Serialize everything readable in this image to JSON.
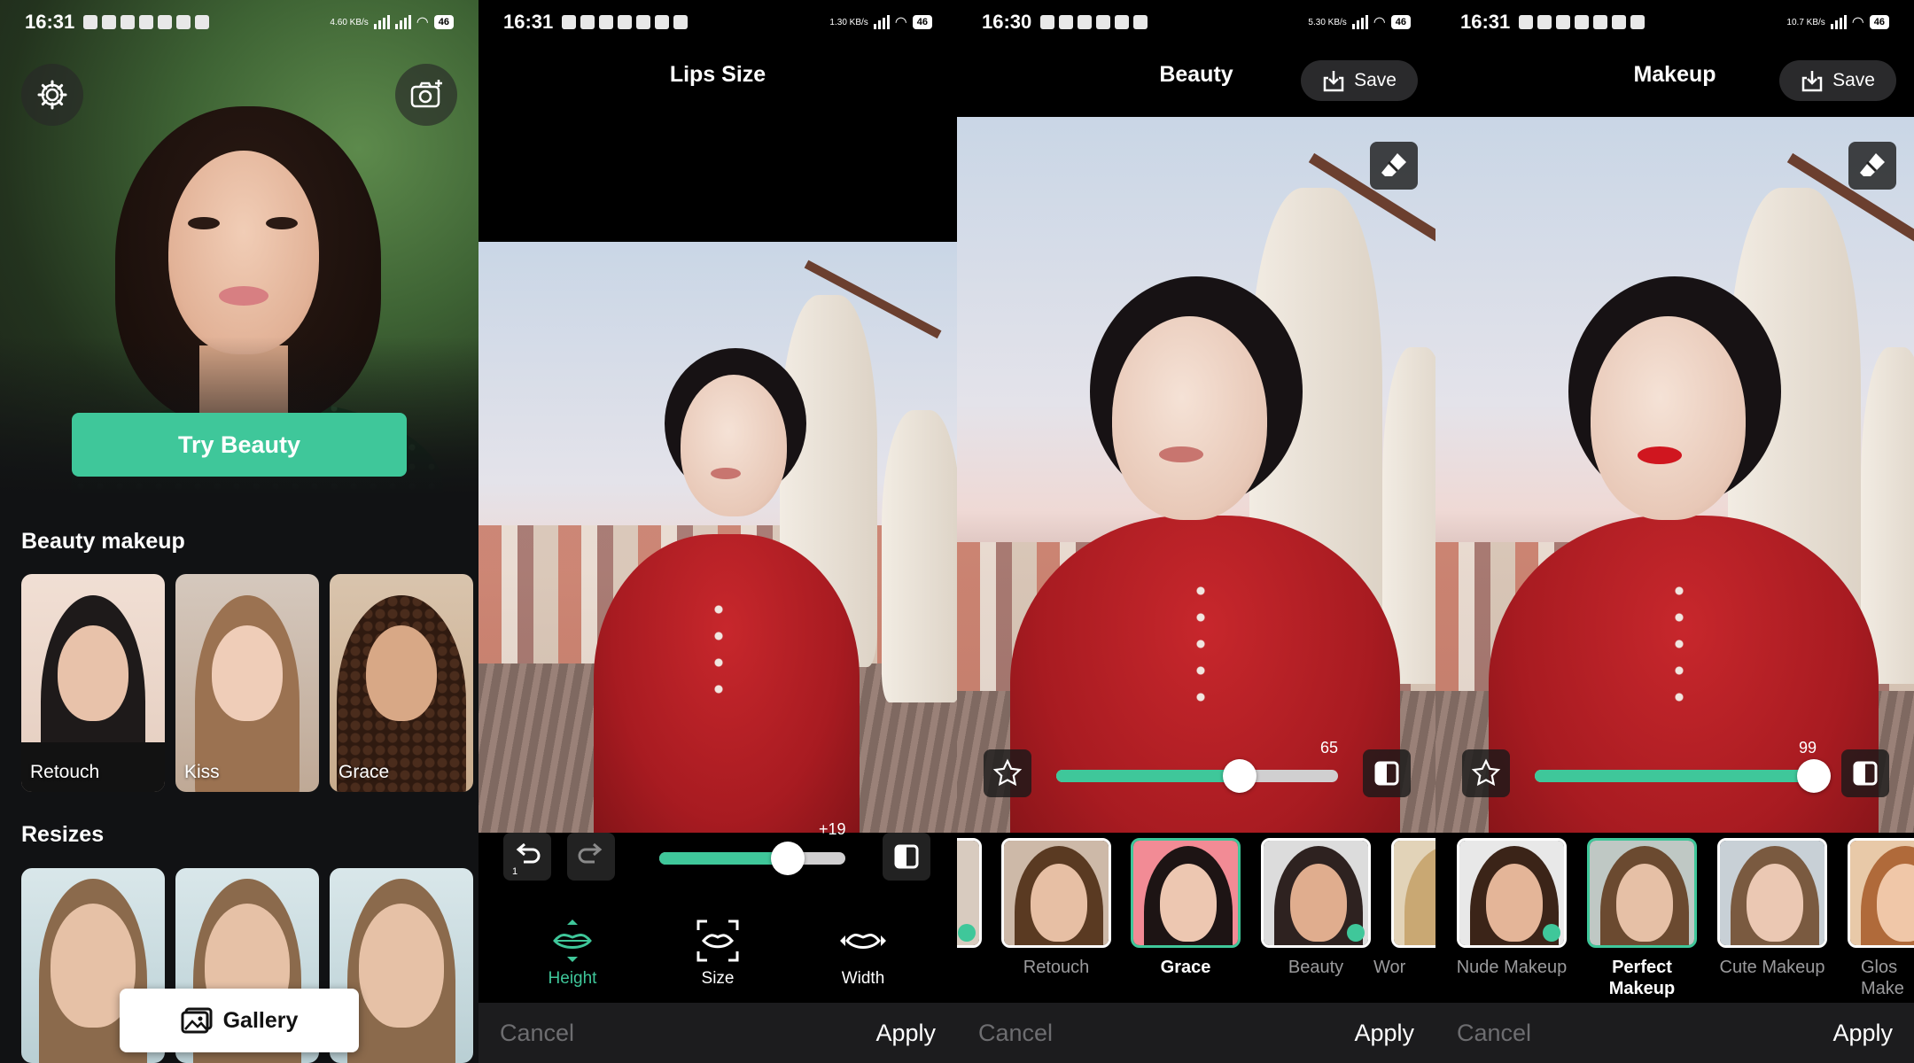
{
  "panel1": {
    "status": {
      "time": "16:31",
      "net": "4.60 KB/s",
      "battery": "46"
    },
    "hero_button": "Try Beauty",
    "section_makeup": "Beauty makeup",
    "makeup_cards": [
      {
        "label": "Retouch"
      },
      {
        "label": "Kiss"
      },
      {
        "label": "Grace"
      }
    ],
    "section_resizes": "Resizes",
    "gallery_button": "Gallery"
  },
  "panel2": {
    "status": {
      "time": "16:31",
      "net": "1.30 KB/s",
      "battery": "46"
    },
    "title": "Lips Size",
    "slider_value": "+19",
    "slider_fraction": 0.69,
    "tools": [
      {
        "label": "Height",
        "active": true
      },
      {
        "label": "Size",
        "active": false
      },
      {
        "label": "Width",
        "active": false
      }
    ],
    "undo_badge": "1",
    "cancel": "Cancel",
    "apply": "Apply"
  },
  "panel3": {
    "status": {
      "time": "16:30",
      "net": "5.30 KB/s",
      "battery": "46"
    },
    "title": "Beauty",
    "save": "Save",
    "slider_value": "65",
    "slider_fraction": 0.65,
    "thumbs": [
      {
        "label": "Retouch",
        "selected": false
      },
      {
        "label": "Grace",
        "selected": true
      },
      {
        "label": "Beauty",
        "selected": false
      },
      {
        "label": "Wor",
        "selected": false
      }
    ],
    "cancel": "Cancel",
    "apply": "Apply"
  },
  "panel4": {
    "status": {
      "time": "16:31",
      "net": "10.7 KB/s",
      "battery": "46"
    },
    "title": "Makeup",
    "save": "Save",
    "slider_value": "99",
    "slider_fraction": 0.99,
    "thumbs": [
      {
        "label": "Nude Makeup",
        "selected": false
      },
      {
        "label": "Perfect Makeup",
        "selected": true
      },
      {
        "label": "Cute Makeup",
        "selected": false
      },
      {
        "label": "Glos Make",
        "selected": false
      }
    ],
    "cancel": "Cancel",
    "apply": "Apply"
  },
  "colors": {
    "accent": "#3fc79a",
    "dark": "#111214",
    "bar": "#1c1c1e"
  }
}
